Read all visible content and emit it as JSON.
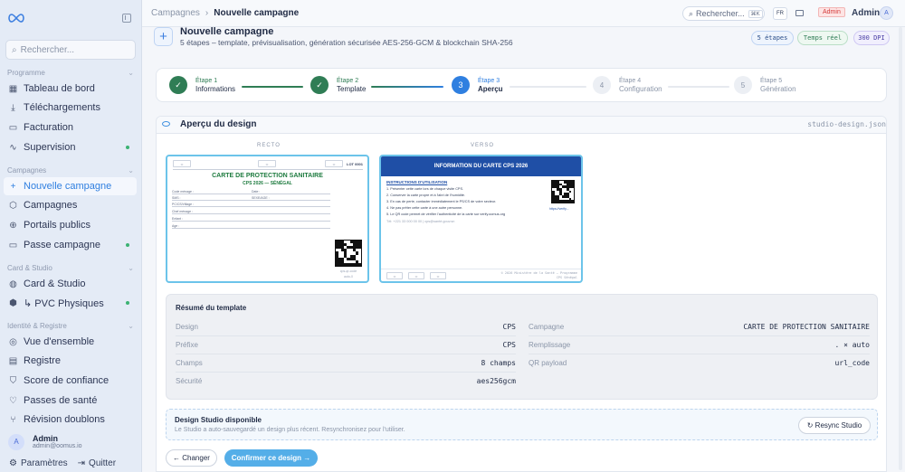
{
  "sidebar": {
    "search_placeholder": "Rechercher...",
    "sections": [
      {
        "title": "Programme",
        "items": [
          {
            "label": "Tableau de bord",
            "icon": "grid-icon",
            "dot": false
          },
          {
            "label": "Téléchargements",
            "icon": "download-icon",
            "dot": false
          },
          {
            "label": "Facturation",
            "icon": "receipt-icon",
            "dot": false
          },
          {
            "label": "Supervision",
            "icon": "activity-icon",
            "dot": true
          }
        ]
      },
      {
        "title": "Campagnes",
        "items": [
          {
            "label": "Nouvelle campagne",
            "icon": "plus-icon",
            "dot": false,
            "active": true
          },
          {
            "label": "Campagnes",
            "icon": "layers-icon",
            "dot": false
          },
          {
            "label": "Portails publics",
            "icon": "globe-icon",
            "dot": false
          },
          {
            "label": "Passe campagne",
            "icon": "pass-icon",
            "dot": true
          }
        ]
      },
      {
        "title": "Card & Studio",
        "items": [
          {
            "label": "Card & Studio",
            "icon": "palette-icon",
            "dot": false
          },
          {
            "label": "↳ PVC Physiques",
            "icon": "box-icon",
            "dot": true
          }
        ]
      },
      {
        "title": "Identité & Registre",
        "items": [
          {
            "label": "Vue d'ensemble",
            "icon": "fingerprint-icon",
            "dot": false
          },
          {
            "label": "Registre",
            "icon": "book-icon",
            "dot": false
          },
          {
            "label": "Score de confiance",
            "icon": "shield-check-icon",
            "dot": false
          },
          {
            "label": "Passes de santé",
            "icon": "heart-icon",
            "dot": false
          },
          {
            "label": "Révision doublons",
            "icon": "merge-icon",
            "dot": false
          }
        ]
      }
    ],
    "user": {
      "initial": "A",
      "name": "Admin",
      "email": "admin@oomus.io"
    },
    "settings_label": "Paramètres",
    "quit_label": "Quitter"
  },
  "topbar": {
    "breadcrumb_root": "Campagnes",
    "breadcrumb_sep": "›",
    "breadcrumb_current": "Nouvelle campagne",
    "search_label": "Rechercher...",
    "search_kbd": "⌘K",
    "lang": "FR",
    "role_badge": "Admin",
    "user_name": "Admin",
    "user_initial": "A"
  },
  "header": {
    "title": "Nouvelle campagne",
    "subtitle": "5 étapes – template, prévisualisation, génération sécurisée AES-256-GCM & blockchain SHA-256",
    "pills": [
      "5 étapes",
      "Temps réel",
      "300 DPI"
    ]
  },
  "stepper": [
    {
      "num": "✓",
      "label": "Étape 1",
      "name": "Informations",
      "state": "done"
    },
    {
      "num": "✓",
      "label": "Étape 2",
      "name": "Template",
      "state": "done"
    },
    {
      "num": "3",
      "label": "Étape 3",
      "name": "Aperçu",
      "state": "current"
    },
    {
      "num": "4",
      "label": "Étape 4",
      "name": "Configuration",
      "state": "todo"
    },
    {
      "num": "5",
      "label": "Étape 5",
      "name": "Génération",
      "state": "todo"
    }
  ],
  "design": {
    "title": "Aperçu du design",
    "file": "studio-design.json",
    "recto_label": "RECTO",
    "verso_label": "VERSO"
  },
  "recto": {
    "top_boxes": [
      "••",
      "••",
      "••"
    ],
    "top_right": "LOT 0001",
    "title": "CARTE DE PROTECTION SANITAIRE",
    "subtitle": "CPS 2026 — SÉNÉGAL",
    "fields_left": [
      "Code ménage :",
      "SMS :",
      "PC/CS/Village :",
      "Chef ménage :",
      "Enfant :",
      "Age :"
    ],
    "fields_right": [
      "Date :",
      "SEXE/AGE :"
    ],
    "qr_caption": "cps-qr-code",
    "qr_sub": "auto-0"
  },
  "verso": {
    "header": "INFORMATION DU CARTE CPS 2026",
    "instructions_title": "INSTRUCTIONS D'UTILISATION",
    "lines": [
      "1. Présenter cette carte lors de chaque visite CPS.",
      "2. Conserver la carte propre et à l'abri de l'humidité.",
      "3. En cas de perte, contacter immédiatement le PS/CS de votre secteur.",
      "4. Ne pas prêter cette carte à une autre personne.",
      "5. Le QR code permet de vérifier l'authenticité de la carte sur verify.oomus.org"
    ],
    "contact": "Tél: +221 33 000 00 00 | cps@santé.gouv.sn",
    "url": "https://verify...",
    "foot_boxes": [
      "••",
      "••",
      "••"
    ],
    "foot_right_1": "© 2026 Ministère de la Santé – Programme",
    "foot_right_2": "CPS Sénégal"
  },
  "resume": {
    "title": "Résumé du template",
    "left": [
      {
        "k": "Design",
        "v": "CPS"
      },
      {
        "k": "Préfixe",
        "v": "CPS"
      },
      {
        "k": "Champs",
        "v": "8 champs"
      },
      {
        "k": "Sécurité",
        "v": "aes256gcm"
      }
    ],
    "right": [
      {
        "k": "Campagne",
        "v": "CARTE DE PROTECTION SANITAIRE"
      },
      {
        "k": "Remplissage",
        "v": ". × auto"
      },
      {
        "k": "QR payload",
        "v": "url_code"
      }
    ]
  },
  "studio": {
    "title": "Design Studio disponible",
    "desc": "Le Studio a auto-sauvegardé un design plus récent. Resynchronisez pour l'utiliser.",
    "resync_label": "↻ Resync Studio"
  },
  "actions": {
    "back_label": "← Changer",
    "confirm_label": "Confirmer ce design →"
  },
  "colors": {
    "accent": "#2f7fe0",
    "done": "#2f7d55",
    "card_border": "#6cc4ea",
    "verso_header": "#1f4fa6"
  }
}
